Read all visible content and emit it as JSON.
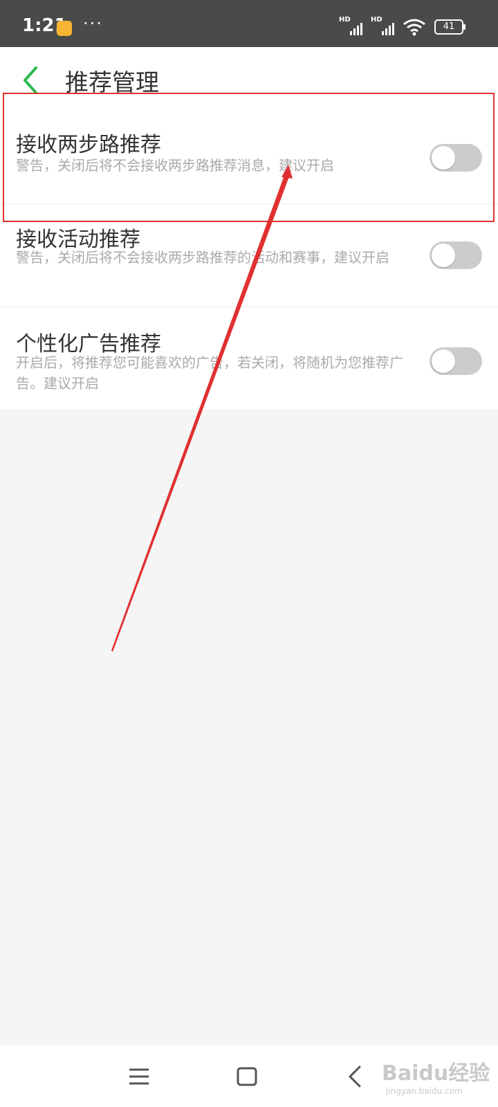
{
  "status_bar": {
    "time": "1:21",
    "dots": "···",
    "hd_label": "HD",
    "battery": "41"
  },
  "header": {
    "title": "推荐管理"
  },
  "settings": [
    {
      "title": "接收两步路推荐",
      "description": "警告，关闭后将不会接收两步路推荐消息，建议开启",
      "enabled": false
    },
    {
      "title": "接收活动推荐",
      "description": "警告，关闭后将不会接收两步路推荐的活动和赛事，建议开启",
      "enabled": false
    },
    {
      "title": "个性化广告推荐",
      "description": "开启后，将推荐您可能喜欢的广告，若关闭，将随机为您推荐广告。建议开启",
      "enabled": false
    }
  ],
  "colors": {
    "accent_green": "#2db84d",
    "highlight_red": "#e03030",
    "toggle_off": "#cccccc"
  },
  "icons": {
    "back": "chevron-left-icon",
    "menu": "menu-icon",
    "home": "square-icon",
    "nav_back": "chevron-left-icon"
  },
  "watermark": {
    "brand": "Baidu经验",
    "url": "jingyan.baidu.com"
  }
}
